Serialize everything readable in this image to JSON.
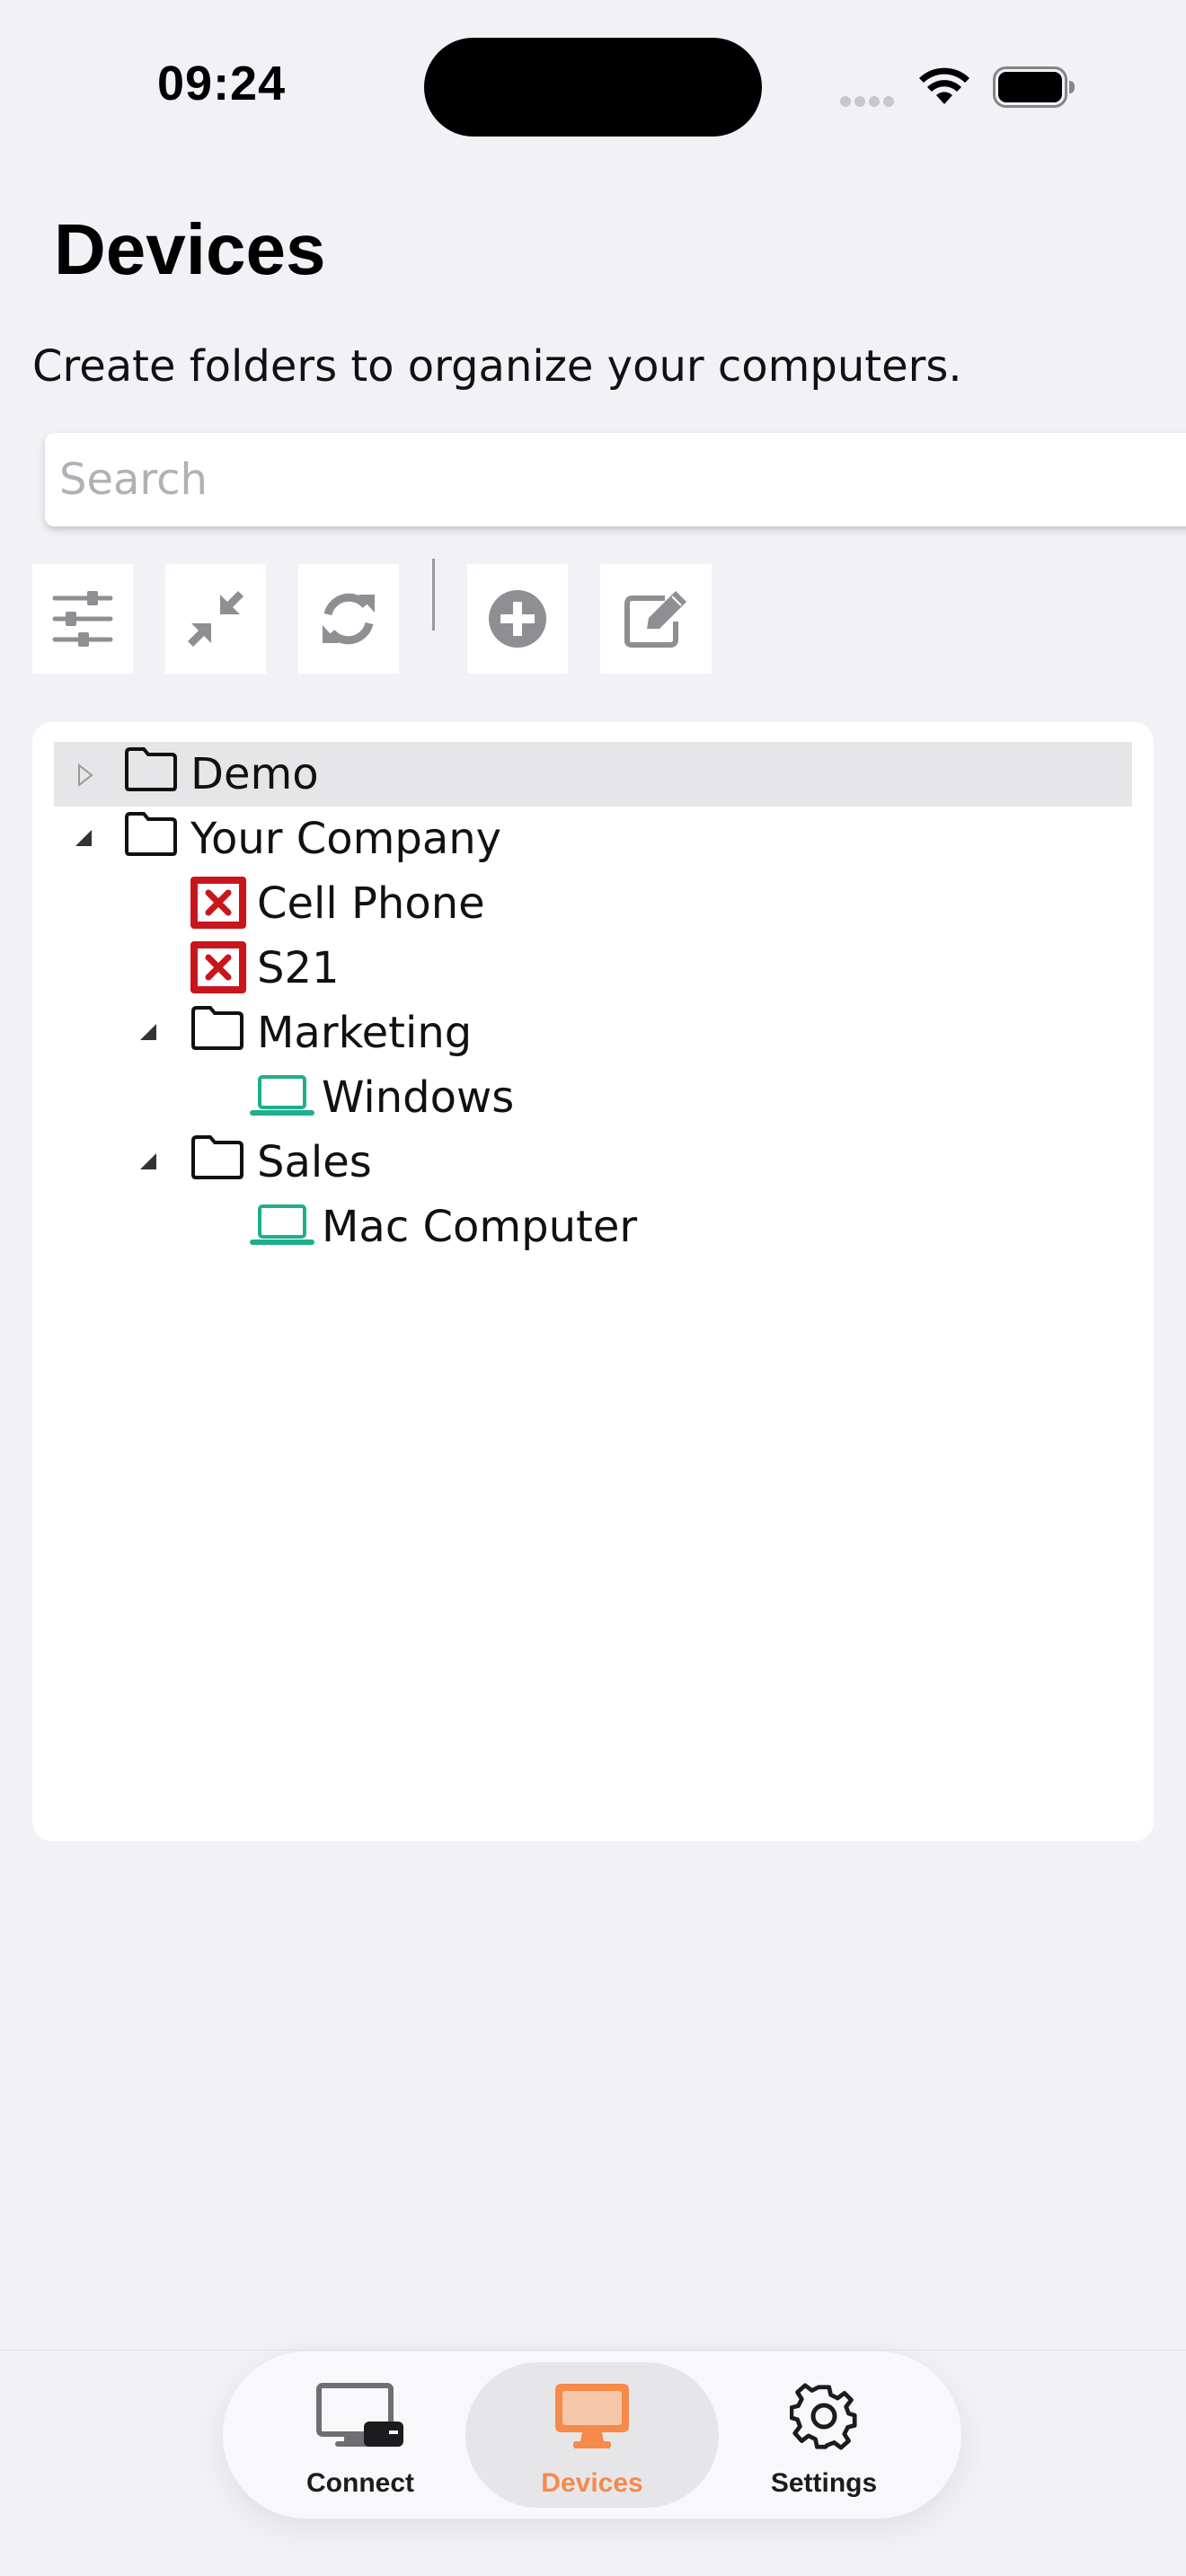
{
  "status_bar": {
    "time": "09:24"
  },
  "page": {
    "title": "Devices",
    "subtitle": "Create folders to organize your computers."
  },
  "search": {
    "placeholder": "Search",
    "value": ""
  },
  "toolbar": {
    "buttons": [
      {
        "icon": "sliders-icon"
      },
      {
        "icon": "collapse-arrows-icon"
      },
      {
        "icon": "refresh-icon"
      },
      {
        "icon": "add-circle-icon"
      },
      {
        "icon": "edit-icon"
      }
    ]
  },
  "tree": {
    "items": [
      {
        "label": "Demo",
        "type": "folder",
        "expanded": false,
        "selected": true
      },
      {
        "label": "Your Company",
        "type": "folder",
        "expanded": true
      },
      {
        "label": "Cell Phone",
        "type": "device",
        "status": "offline",
        "icon": "error-x-icon"
      },
      {
        "label": "S21",
        "type": "device",
        "status": "offline",
        "icon": "error-x-icon"
      },
      {
        "label": "Marketing",
        "type": "folder",
        "expanded": true
      },
      {
        "label": "Windows",
        "type": "device",
        "status": "online",
        "icon": "laptop-icon"
      },
      {
        "label": "Sales",
        "type": "folder",
        "expanded": true
      },
      {
        "label": "Mac Computer",
        "type": "device",
        "status": "online",
        "icon": "laptop-icon"
      }
    ]
  },
  "tab_bar": {
    "tabs": [
      {
        "label": "Connect",
        "icon": "monitor-connect-icon",
        "active": false
      },
      {
        "label": "Devices",
        "icon": "monitor-icon",
        "active": true
      },
      {
        "label": "Settings",
        "icon": "gear-icon",
        "active": false
      }
    ]
  },
  "colors": {
    "accent": "#f58a4a",
    "online": "#1fae8c",
    "offline": "#c8161d",
    "background": "#f2f1f6",
    "toolbar_icon": "#8e8e93"
  }
}
